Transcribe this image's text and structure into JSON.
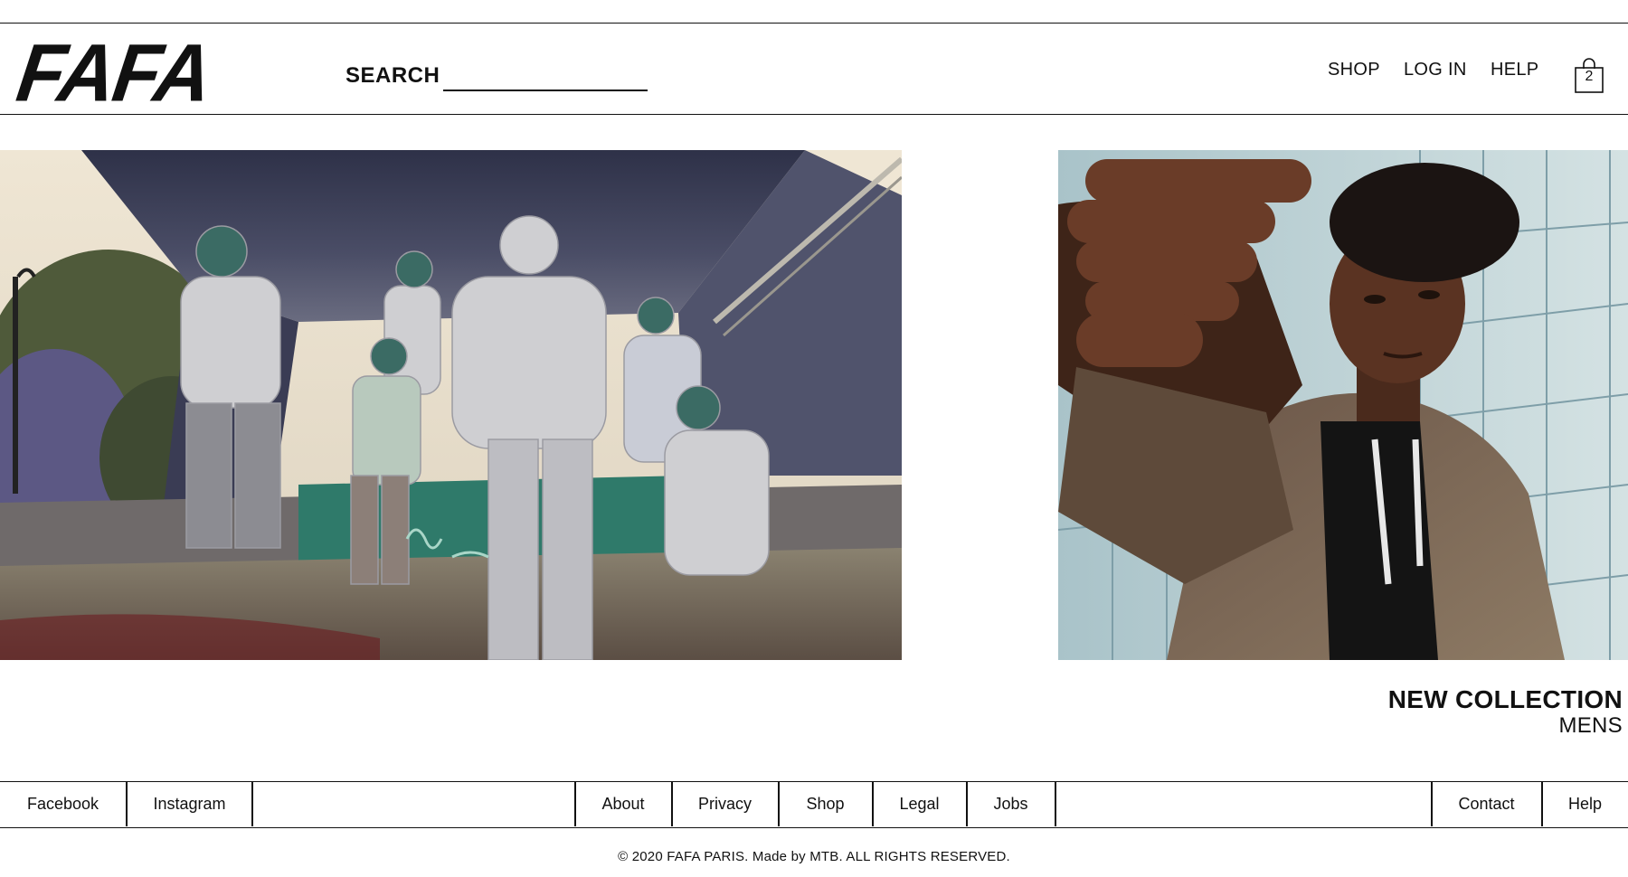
{
  "header": {
    "logo": "FAFA",
    "search_label": "SEARCH",
    "search_placeholder": "",
    "nav": {
      "shop": "SHOP",
      "login": "LOG IN",
      "help": "HELP"
    },
    "cart_count": "2"
  },
  "collection": {
    "title": "NEW COLLECTION",
    "subtitle": "MENS"
  },
  "footer": {
    "links": {
      "facebook": "Facebook",
      "instagram": "Instagram",
      "about": "About",
      "privacy": "Privacy",
      "shop": "Shop",
      "legal": "Legal",
      "jobs": "Jobs",
      "contact": "Contact",
      "help": "Help"
    },
    "copyright": "© 2020 FAFA PARIS. Made by MTB. ALL RIGHTS RESERVED."
  },
  "colors": {
    "text": "#111111",
    "background": "#ffffff"
  },
  "icons": {
    "cart": "shopping-bag-icon"
  }
}
